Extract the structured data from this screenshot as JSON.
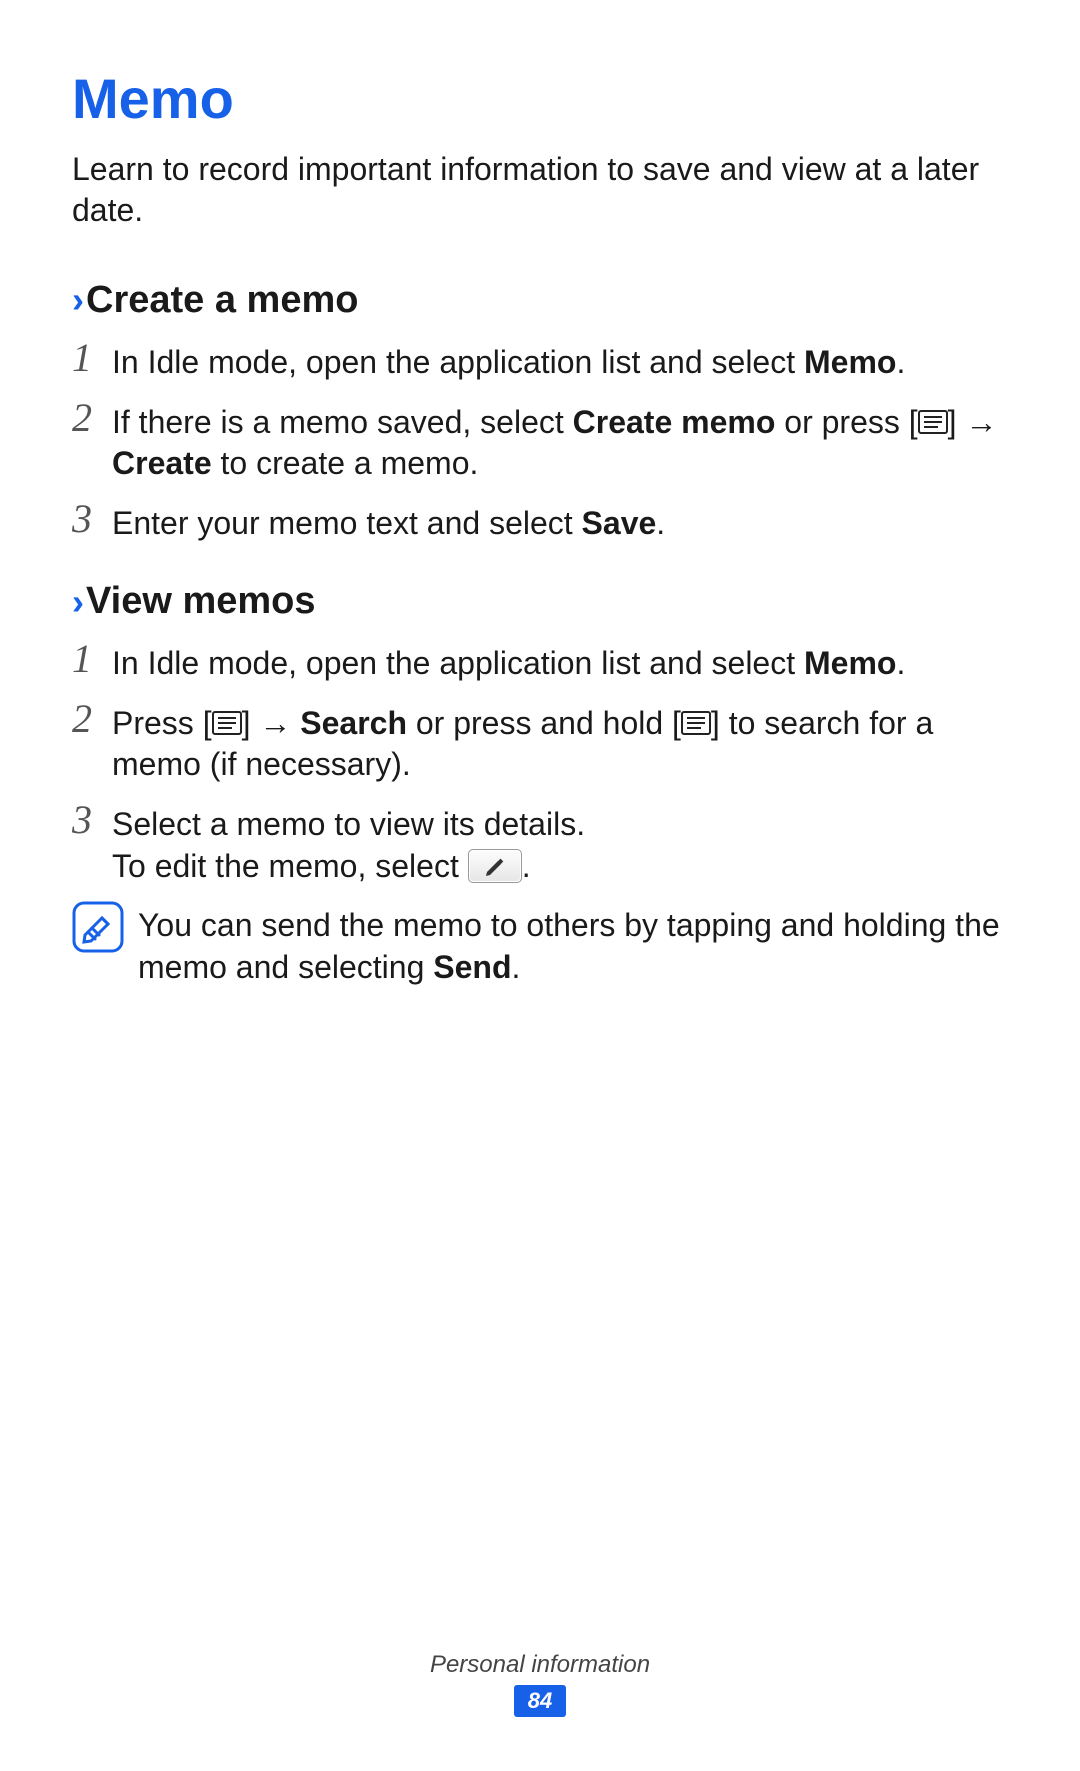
{
  "title": "Memo",
  "intro": "Learn to record important information to save and view at a later date.",
  "sections": {
    "create": {
      "heading": "Create a memo",
      "steps": {
        "s1_pre": "In Idle mode, open the application list and select ",
        "s1_bold": "Memo",
        "s1_post": ".",
        "s2_pre": "If there is a memo saved, select ",
        "s2_bold1": "Create memo",
        "s2_mid": " or press [",
        "s2_arrow": "] → ",
        "s2_bold2": "Create",
        "s2_post": " to create a memo.",
        "s3_pre": "Enter your memo text and select ",
        "s3_bold": "Save",
        "s3_post": "."
      }
    },
    "view": {
      "heading": "View memos",
      "steps": {
        "s1_pre": "In Idle mode, open the application list and select ",
        "s1_bold": "Memo",
        "s1_post": ".",
        "s2_pre": "Press [",
        "s2_arrow1": "] → ",
        "s2_bold": "Search",
        "s2_mid": " or press and hold [",
        "s2_post": "] to search for a memo (if necessary).",
        "s3_line1": "Select a memo to view its details.",
        "s3_line2_pre": "To edit the memo, select ",
        "s3_line2_post": "."
      },
      "note_pre": "You can send the memo to others by tapping and holding the memo and selecting ",
      "note_bold": "Send",
      "note_post": "."
    }
  },
  "footer": {
    "section": "Personal information",
    "page": "84"
  },
  "nums": {
    "n1": "1",
    "n2": "2",
    "n3": "3"
  },
  "chevron": "›"
}
